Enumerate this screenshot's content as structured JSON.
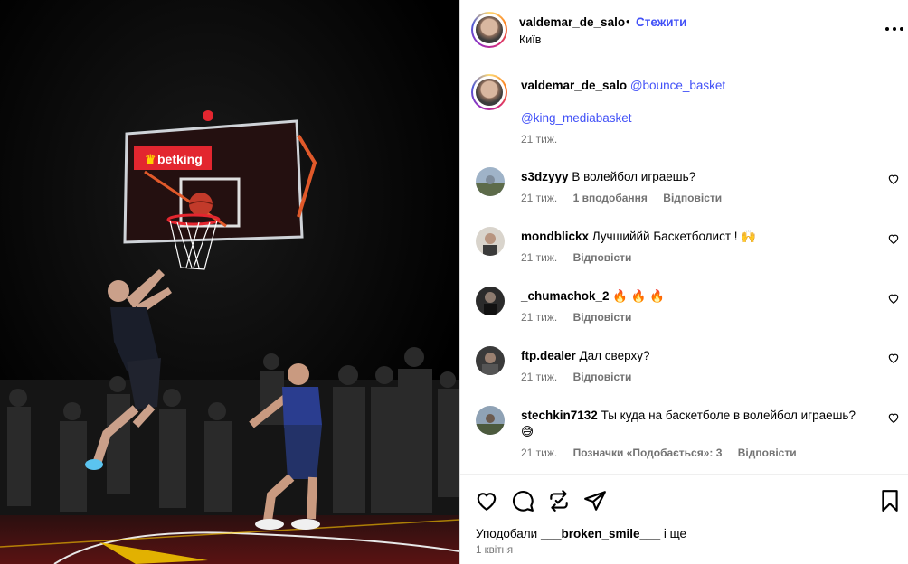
{
  "post": {
    "author": "valdemar_de_salo",
    "separator": "•",
    "follow_label": "Стежити",
    "location": "Київ"
  },
  "photo": {
    "sponsor_logo_text": "betking"
  },
  "caption": {
    "author": "valdemar_de_salo",
    "mention1": "@bounce_basket",
    "mention2": "@king_mediabasket",
    "time": "21 тиж."
  },
  "comments": [
    {
      "user": "s3dzyyy",
      "text": "В волейбол играешь?",
      "time": "21 тиж.",
      "likes": "1 вподобання",
      "reply": "Відповісти"
    },
    {
      "user": "mondblickx",
      "text": "Лучшиййй Баскетболист ! 🙌",
      "time": "21 тиж.",
      "likes": "",
      "reply": "Відповісти"
    },
    {
      "user": "_chumachok_2",
      "text": "🔥 🔥 🔥",
      "time": "21 тиж.",
      "likes": "",
      "reply": "Відповісти"
    },
    {
      "user": "ftp.dealer",
      "text": "Дал сверху?",
      "time": "21 тиж.",
      "likes": "",
      "reply": "Відповісти"
    },
    {
      "user": "stechkin7132",
      "text": "Ты куда на баскетболе в волейбол играешь? 😅",
      "time": "21 тиж.",
      "likes": "Позначки «Подобається»: 3",
      "reply": "Відповісти"
    }
  ],
  "footer": {
    "liked_prefix": "Уподобали ",
    "liked_user": "___broken_smile___",
    "liked_suffix": " і ще",
    "date": "1 квітня"
  },
  "icons": {
    "more": "more-options-icon",
    "heart": "heart-icon",
    "comment": "comment-icon",
    "repost": "repost-icon",
    "share": "share-icon",
    "save": "bookmark-icon"
  },
  "colors": {
    "link": "#4150f7",
    "muted": "#737373",
    "sponsor": "#e3262f",
    "jersey": "#2a3d8f",
    "court_accent": "#c62828"
  }
}
